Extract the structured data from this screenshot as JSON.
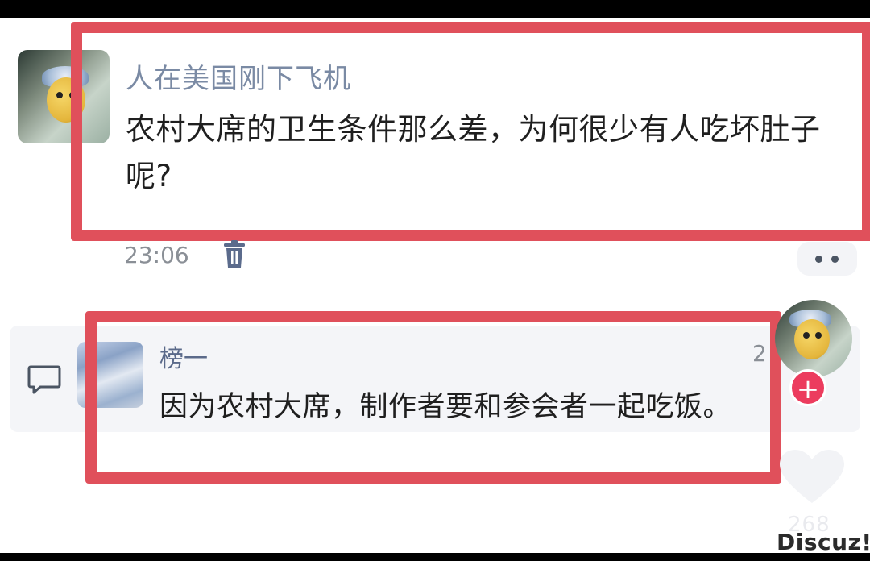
{
  "post": {
    "author": "人在美国刚下飞机",
    "text": "农村大席的卫生条件那么差，为何很少有人吃坏肚子呢?",
    "time": "23:06"
  },
  "reply": {
    "author": "榜一",
    "text": "因为农村大席，制作者要和参会者一起吃饭。",
    "meta_cut": "2"
  },
  "side": {
    "like_count": "268",
    "follow_symbol": "+"
  },
  "watermark": "Discuz!",
  "icons": {
    "delete": "trash-icon",
    "more": "more-icon",
    "comment": "comment-icon",
    "like": "heart-icon",
    "follow": "plus-icon"
  },
  "colors": {
    "highlight_box": "#e0505b",
    "follow_button": "#ec3c5e",
    "author_name": "#7a8aa4"
  }
}
